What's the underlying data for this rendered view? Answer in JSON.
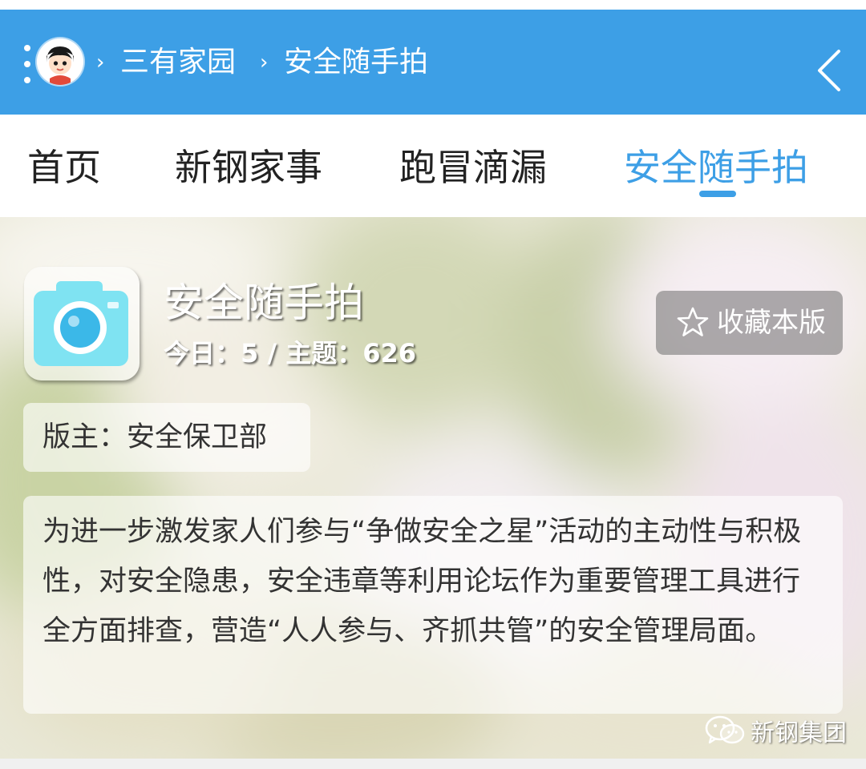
{
  "header": {
    "breadcrumb": [
      {
        "label": "三有家园"
      },
      {
        "label": "安全随手拍"
      }
    ],
    "separator": "›",
    "icons": {
      "menu": "more-vertical-icon",
      "avatar": "user-avatar",
      "back": "chevron-left-icon"
    },
    "background_color": "#3d9fe6"
  },
  "tabs": [
    {
      "label": "首页",
      "active": false
    },
    {
      "label": "新钢家事",
      "active": false
    },
    {
      "label": "跑冒滴漏",
      "active": false
    },
    {
      "label": "安全随手拍",
      "active": true
    }
  ],
  "forum": {
    "icon": "camera-icon",
    "title": "安全随手拍",
    "stats": "今日：5 / 主题：626",
    "favorite_button": {
      "label": "收藏本版",
      "icon": "star-outline-icon"
    },
    "moderator": "版主：安全保卫部",
    "description": "为进一步激发家人们参与“争做安全之星”活动的主动性与积极性，对安全隐患，安全违章等利用论坛作为重要管理工具进行全方面排查，营造“人人参与、齐抓共管”的安全管理局面。"
  },
  "watermark": {
    "icon": "wechat-icon",
    "text": "新钢集团"
  },
  "colors": {
    "accent": "#3d9fe6",
    "camera": "#7fe3f2",
    "text_dark": "#333333"
  }
}
